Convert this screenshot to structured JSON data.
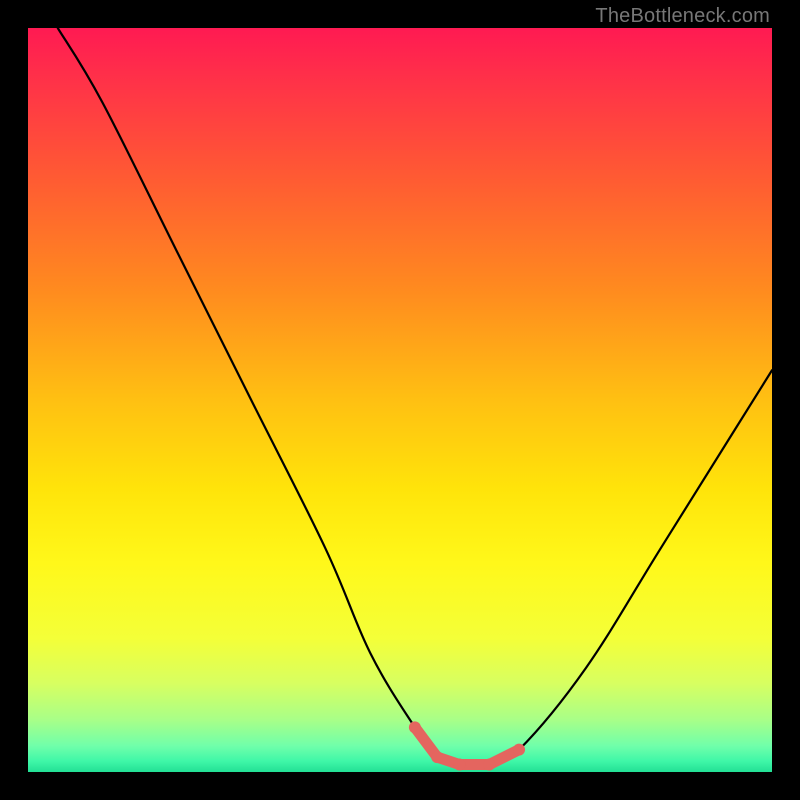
{
  "watermark": "TheBottleneck.com",
  "gradient_stops": [
    {
      "offset": 0.0,
      "color": "#ff1a52"
    },
    {
      "offset": 0.06,
      "color": "#ff2e4a"
    },
    {
      "offset": 0.2,
      "color": "#ff5a33"
    },
    {
      "offset": 0.35,
      "color": "#ff8a1f"
    },
    {
      "offset": 0.5,
      "color": "#ffc012"
    },
    {
      "offset": 0.62,
      "color": "#ffe40a"
    },
    {
      "offset": 0.72,
      "color": "#fff81a"
    },
    {
      "offset": 0.82,
      "color": "#f4ff38"
    },
    {
      "offset": 0.88,
      "color": "#d8ff60"
    },
    {
      "offset": 0.93,
      "color": "#a8ff88"
    },
    {
      "offset": 0.965,
      "color": "#70ffaa"
    },
    {
      "offset": 0.985,
      "color": "#40f7a8"
    },
    {
      "offset": 1.0,
      "color": "#22e095"
    }
  ],
  "chart_data": {
    "type": "line",
    "title": "",
    "xlabel": "",
    "ylabel": "",
    "xlim": [
      0,
      100
    ],
    "ylim": [
      0,
      100
    ],
    "grid": false,
    "legend": false,
    "series": [
      {
        "name": "bottleneck-curve",
        "x": [
          4,
          10,
          20,
          30,
          40,
          46,
          52,
          55,
          58,
          62,
          66,
          75,
          85,
          95,
          100
        ],
        "y": [
          100,
          90,
          70,
          50,
          30,
          16,
          6,
          2,
          1,
          1,
          3,
          14,
          30,
          46,
          54
        ]
      },
      {
        "name": "flat-bottom-marker",
        "x": [
          52,
          55,
          58,
          62,
          66
        ],
        "y": [
          6,
          2,
          1,
          1,
          3
        ]
      }
    ],
    "annotations": []
  },
  "marker_color": "#e4655f",
  "curve_color": "#000000"
}
